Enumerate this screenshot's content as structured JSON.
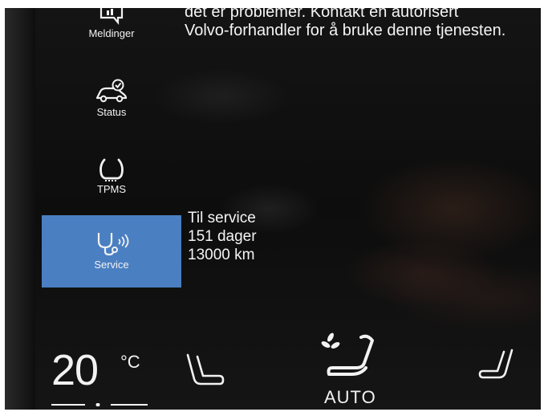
{
  "message": {
    "line1": "det er problemer. Kontakt en autorisert",
    "line2": "Volvo-forhandler for å bruke denne tjenesten."
  },
  "sidebar": {
    "items": [
      {
        "label": "Meldinger",
        "icon": "messages-icon",
        "active": false
      },
      {
        "label": "Status",
        "icon": "car-status-icon",
        "active": false
      },
      {
        "label": "TPMS",
        "icon": "tire-pressure-icon",
        "active": false
      },
      {
        "label": "Service",
        "icon": "service-icon",
        "active": true
      }
    ]
  },
  "service": {
    "title": "Til service",
    "days": "151 dager",
    "distance": "13000 km"
  },
  "climate": {
    "temperature": "20",
    "unit": "°C",
    "auto_label": "AUTO"
  },
  "colors": {
    "accent": "#4a7fc2",
    "text": "#f2f2f2",
    "background": "#111111"
  }
}
